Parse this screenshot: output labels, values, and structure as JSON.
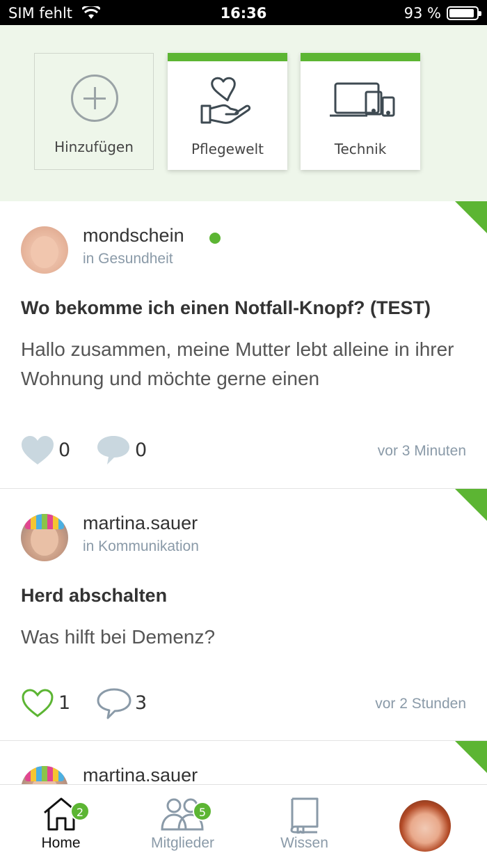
{
  "status_bar": {
    "carrier": "SIM fehlt",
    "time": "16:36",
    "battery_percent": "93 %",
    "battery_level": 0.93
  },
  "categories": {
    "add_label": "Hinzufügen",
    "items": [
      {
        "label": "Pflegewelt",
        "icon": "heart-hand-icon"
      },
      {
        "label": "Technik",
        "icon": "devices-icon"
      }
    ]
  },
  "posts": [
    {
      "username": "mondschein",
      "online": true,
      "group": "in Gesundheit",
      "title": "Wo bekomme ich einen Notfall-Knopf? (TEST)",
      "body": "Hallo zusammen, meine Mutter lebt alleine in ihrer Wohnung und möchte gerne einen",
      "likes": "0",
      "comments": "0",
      "liked": false,
      "time": "vor 3 Minuten"
    },
    {
      "username": "martina.sauer",
      "online": false,
      "group": "in Kommunikation",
      "title": "Herd abschalten",
      "body": "Was hilft bei Demenz?",
      "likes": "1",
      "comments": "3",
      "liked": true,
      "time": "vor 2 Stunden"
    },
    {
      "username": "martina.sauer"
    }
  ],
  "tabs": [
    {
      "label": "Home",
      "badge": "2",
      "icon": "home-icon",
      "active": true
    },
    {
      "label": "Mitglieder",
      "badge": "5",
      "icon": "members-icon",
      "active": false
    },
    {
      "label": "Wissen",
      "icon": "book-icon",
      "active": false
    }
  ],
  "colors": {
    "accent": "#5cb533",
    "strip_background": "#eef6ea",
    "muted_text": "#8a9aa8"
  }
}
